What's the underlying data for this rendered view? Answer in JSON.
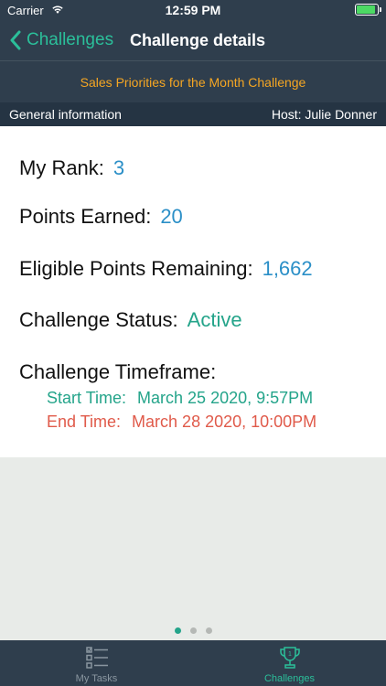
{
  "status_bar": {
    "carrier": "Carrier",
    "time": "12:59 PM"
  },
  "nav": {
    "back_label": "Challenges",
    "title": "Challenge details"
  },
  "challenge": {
    "name": "Sales Priorities for the Month Challenge"
  },
  "info_bar": {
    "left": "General information",
    "right": "Host: Julie Donner"
  },
  "details": {
    "rank_label": "My Rank:",
    "rank_value": "3",
    "points_label": "Points Earned:",
    "points_value": "20",
    "eligible_label": "Eligible Points Remaining:",
    "eligible_value": "1,662",
    "status_label": "Challenge Status:",
    "status_value": "Active",
    "timeframe_label": "Challenge Timeframe:",
    "start_label": "Start Time:",
    "start_value": "March 25 2020, 9:57PM",
    "end_label": "End Time:",
    "end_value": "March 28 2020, 10:00PM"
  },
  "pager": {
    "total": 3,
    "current": 1
  },
  "tabs": [
    {
      "label": "My Tasks",
      "icon": "checklist-icon",
      "active": false
    },
    {
      "label": "Challenges",
      "icon": "trophy-icon",
      "active": true
    }
  ],
  "colors": {
    "nav_bg": "#2f3e4d",
    "accent_green": "#2bbf9a",
    "banner_orange": "#f5a623",
    "value_blue": "#2b8fc7",
    "status_green": "#24a48a",
    "end_red": "#e05a4a"
  }
}
